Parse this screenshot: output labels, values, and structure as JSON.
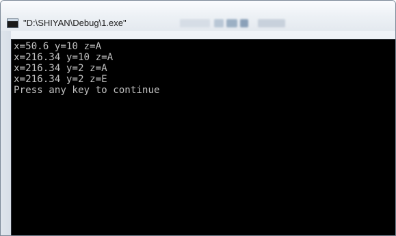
{
  "window": {
    "title": "\"D:\\SHIYAN\\Debug\\1.exe\""
  },
  "console": {
    "lines": [
      "x=50.6 y=10 z=A",
      "x=216.34 y=10 z=A",
      "x=216.34 y=2 z=A",
      "x=216.34 y=2 z=E",
      "Press any key to continue"
    ],
    "text_color": "#c0c0c0",
    "background_color": "#000000"
  },
  "icons": {
    "app_icon": "console-window-icon"
  }
}
